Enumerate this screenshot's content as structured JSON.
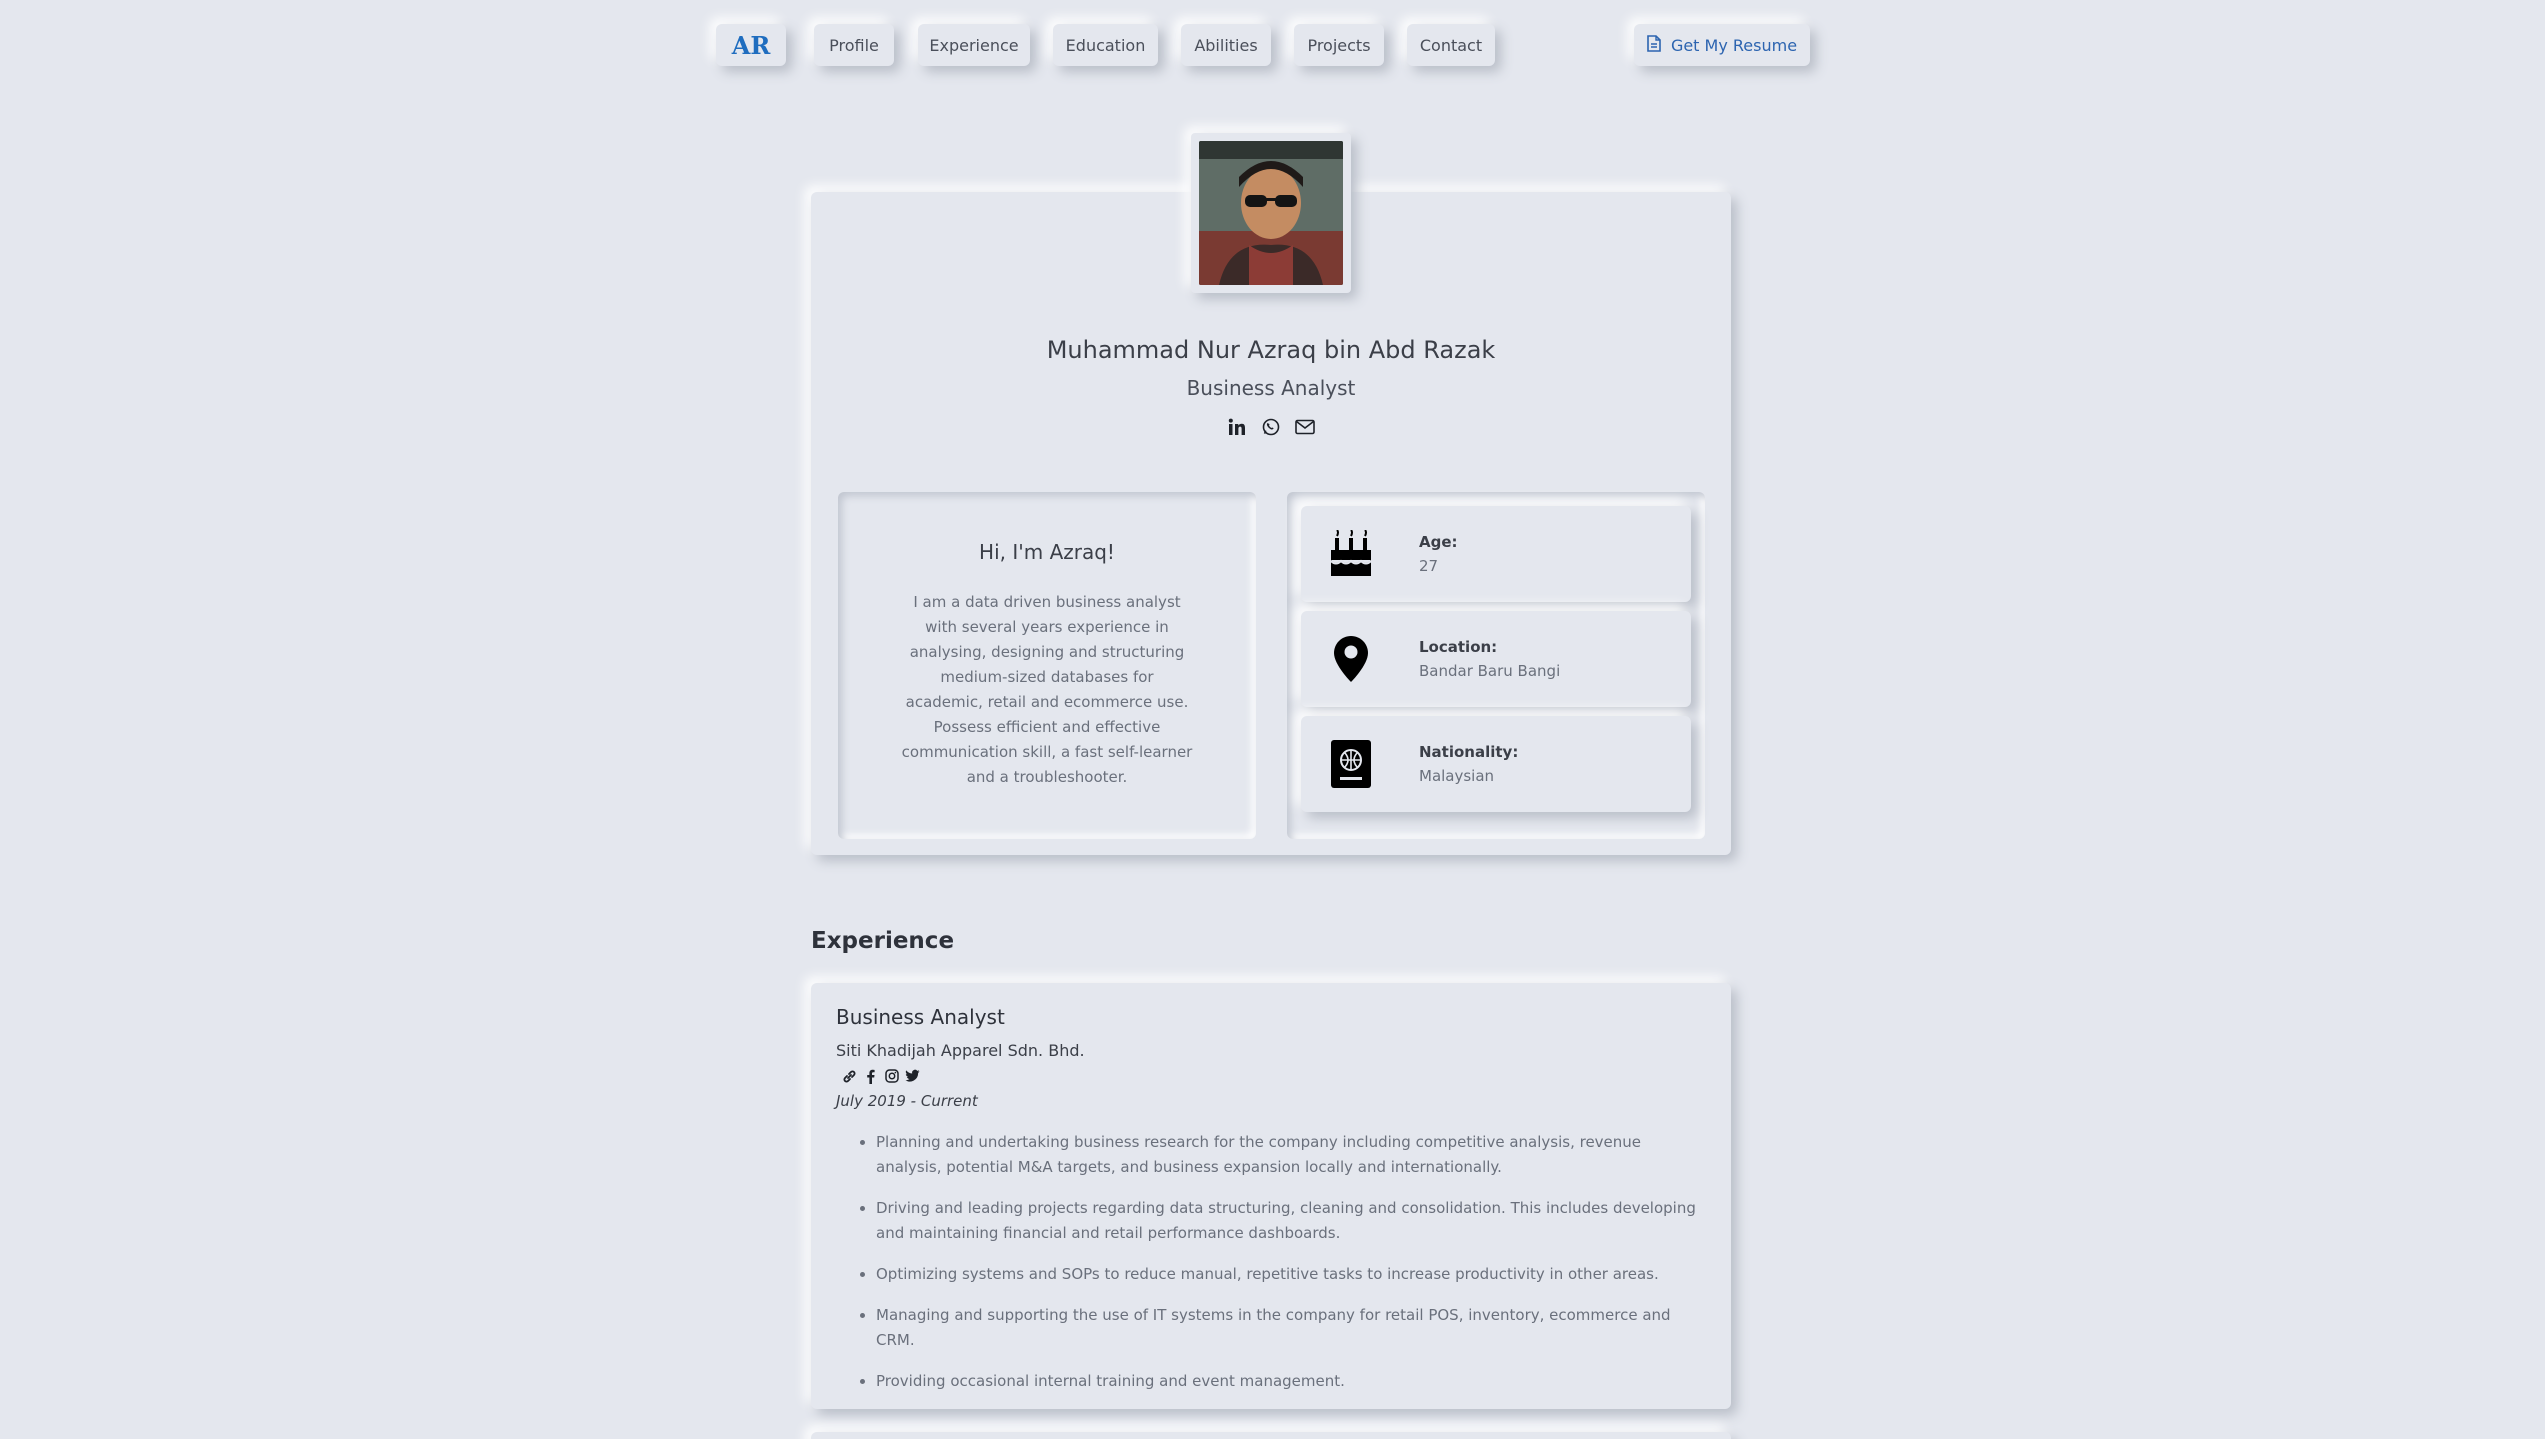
{
  "nav": {
    "logo": "AR",
    "items": [
      {
        "label": "Profile"
      },
      {
        "label": "Experience"
      },
      {
        "label": "Education"
      },
      {
        "label": "Abilities"
      },
      {
        "label": "Projects"
      },
      {
        "label": "Contact"
      }
    ],
    "resume_label": "Get My Resume"
  },
  "profile": {
    "name": "Muhammad Nur Azraq bin Abd Razak",
    "role": "Business Analyst",
    "socials": [
      "linkedin-icon",
      "whatsapp-icon",
      "envelope-icon"
    ]
  },
  "intro": {
    "title": "Hi, I'm Azraq!",
    "text": "I am a data driven business analyst with several years experience in analysing, designing and structuring medium-sized databases for academic, retail and ecommerce use. Possess efficient and effective communication skill, a fast self-learner and a troubleshooter."
  },
  "facts": [
    {
      "icon": "birthday-cake-icon",
      "label": "Age:",
      "value": "27"
    },
    {
      "icon": "map-pin-icon",
      "label": "Location:",
      "value": "Bandar Baru Bangi"
    },
    {
      "icon": "passport-icon",
      "label": "Nationality:",
      "value": "Malaysian"
    }
  ],
  "experience": {
    "heading": "Experience",
    "jobs": [
      {
        "title": "Business Analyst",
        "company": "Siti Khadijah Apparel Sdn. Bhd.",
        "links": [
          "link-icon",
          "facebook-icon",
          "instagram-icon",
          "twitter-icon"
        ],
        "period": "July 2019 - Current",
        "bullets": [
          "Planning and undertaking business research for the company including competitive analysis, revenue analysis, potential M&A targets, and business expansion locally and internationally.",
          "Driving and leading projects regarding data structuring, cleaning and consolidation. This includes developing and maintaining financial and retail performance dashboards.",
          "Optimizing systems and SOPs to reduce manual, repetitive tasks to increase productivity in other areas.",
          "Managing and supporting the use of IT systems in the company for retail POS, inventory, ecommerce and CRM.",
          "Providing occasional internal training and event management."
        ]
      }
    ]
  },
  "colors": {
    "background": "#e4e7ee",
    "accent": "#1f6dbf",
    "text": "#3a3f4a"
  }
}
